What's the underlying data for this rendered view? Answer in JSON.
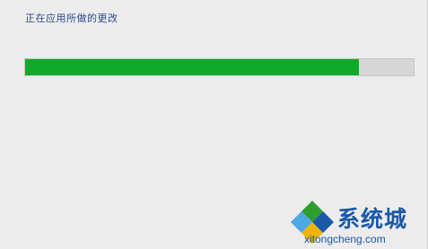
{
  "status": {
    "text": "正在应用所做的更改"
  },
  "progress": {
    "percent": 86,
    "fill_color": "#0faa2a",
    "track_color": "#d6d6d6"
  },
  "watermark": {
    "brand_cn": "系统城",
    "domain": "xitongcheng.com",
    "colors": {
      "blue": "#1b58a8",
      "green": "#2e9e2e",
      "light_blue": "#4ea8e6"
    }
  }
}
